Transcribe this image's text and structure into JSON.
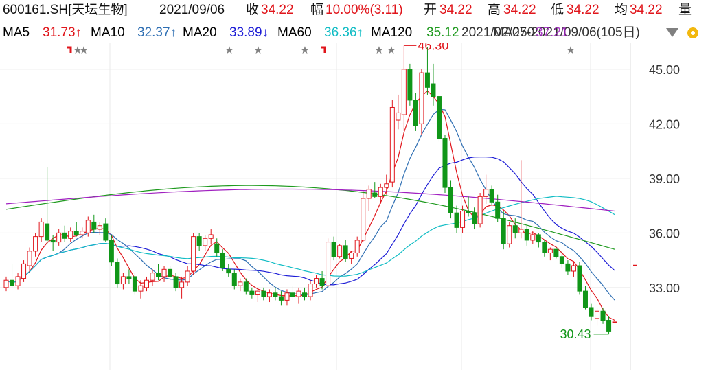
{
  "header": {
    "code": "600161.SH[天坛生物]",
    "date": "2021/09/06",
    "close_label": "收",
    "close": "34.22",
    "change_label": "幅",
    "change": "10.00%(3.11)",
    "open_label": "开",
    "open": "34.22",
    "high_label": "高",
    "high": "34.22",
    "low_label": "低",
    "low": "34.22",
    "avg_label": "均",
    "avg": "34.22",
    "vol_label": "量"
  },
  "ma_bar": {
    "items": [
      {
        "label": "MA5",
        "value": "31.73↑",
        "color": "#e0151b"
      },
      {
        "label": "MA10",
        "value": "32.37↑",
        "color": "#2f6fb3"
      },
      {
        "label": "MA20",
        "value": "33.89↓",
        "color": "#1c1cd6"
      },
      {
        "label": "MA60",
        "value": "36.36↑",
        "color": "#10bcc4"
      },
      {
        "label": "MA120",
        "value": "35.12",
        "color": "#1f9a1f"
      }
    ],
    "range_text": "2021/02/07-2021/09/06(105日)",
    "overlay_text": "MA250",
    "overlay_value": "37.21"
  },
  "chart_data": {
    "type": "candlestick",
    "ylim": [
      30.0,
      47.5
    ],
    "yticks": [
      "33.00",
      "36.00",
      "39.00",
      "42.00",
      "45.00"
    ],
    "high_annotation": "46.30",
    "low_annotation": "30.43",
    "grid": true,
    "colors": {
      "up": "#e0151b",
      "down": "#109618",
      "ma5": "#e0151b",
      "ma10": "#2f6fb3",
      "ma20": "#1c1cd6",
      "ma60": "#10bcc4",
      "ma120": "#1f9a1f",
      "ma250": "#a020c0"
    },
    "candles": [
      {
        "o": 33.0,
        "h": 33.6,
        "l": 32.8,
        "c": 33.4
      },
      {
        "o": 33.4,
        "h": 34.3,
        "l": 33.0,
        "c": 33.1
      },
      {
        "o": 33.1,
        "h": 33.8,
        "l": 32.9,
        "c": 33.6
      },
      {
        "o": 33.5,
        "h": 34.5,
        "l": 33.3,
        "c": 34.3
      },
      {
        "o": 34.2,
        "h": 35.2,
        "l": 33.8,
        "c": 35.0
      },
      {
        "o": 35.0,
        "h": 36.0,
        "l": 34.7,
        "c": 35.8
      },
      {
        "o": 35.8,
        "h": 36.8,
        "l": 35.5,
        "c": 36.6
      },
      {
        "o": 36.5,
        "h": 39.6,
        "l": 35.4,
        "c": 35.6
      },
      {
        "o": 35.6,
        "h": 35.9,
        "l": 35.0,
        "c": 35.5
      },
      {
        "o": 35.5,
        "h": 36.2,
        "l": 35.3,
        "c": 36.0
      },
      {
        "o": 36.0,
        "h": 36.4,
        "l": 35.5,
        "c": 35.7
      },
      {
        "o": 35.7,
        "h": 36.3,
        "l": 35.5,
        "c": 36.1
      },
      {
        "o": 36.1,
        "h": 36.6,
        "l": 35.8,
        "c": 35.9
      },
      {
        "o": 35.9,
        "h": 36.3,
        "l": 35.7,
        "c": 36.1
      },
      {
        "o": 36.0,
        "h": 36.9,
        "l": 35.8,
        "c": 36.7
      },
      {
        "o": 36.6,
        "h": 37.0,
        "l": 36.0,
        "c": 36.2
      },
      {
        "o": 36.2,
        "h": 36.6,
        "l": 35.9,
        "c": 36.4
      },
      {
        "o": 36.5,
        "h": 36.8,
        "l": 35.5,
        "c": 35.6
      },
      {
        "o": 35.6,
        "h": 35.9,
        "l": 34.2,
        "c": 34.4
      },
      {
        "o": 34.4,
        "h": 34.6,
        "l": 33.0,
        "c": 33.2
      },
      {
        "o": 33.2,
        "h": 33.8,
        "l": 32.9,
        "c": 33.6
      },
      {
        "o": 33.6,
        "h": 34.0,
        "l": 33.2,
        "c": 33.5
      },
      {
        "o": 33.6,
        "h": 33.8,
        "l": 32.6,
        "c": 32.8
      },
      {
        "o": 32.8,
        "h": 33.4,
        "l": 32.4,
        "c": 33.1
      },
      {
        "o": 33.0,
        "h": 33.6,
        "l": 32.8,
        "c": 33.4
      },
      {
        "o": 33.4,
        "h": 34.0,
        "l": 33.1,
        "c": 33.8
      },
      {
        "o": 33.8,
        "h": 34.3,
        "l": 33.4,
        "c": 33.6
      },
      {
        "o": 33.6,
        "h": 34.2,
        "l": 33.3,
        "c": 34.0
      },
      {
        "o": 34.0,
        "h": 34.2,
        "l": 33.4,
        "c": 33.6
      },
      {
        "o": 33.6,
        "h": 33.8,
        "l": 32.8,
        "c": 33.0
      },
      {
        "o": 33.0,
        "h": 33.6,
        "l": 32.4,
        "c": 33.3
      },
      {
        "o": 33.3,
        "h": 34.2,
        "l": 33.1,
        "c": 33.9
      },
      {
        "o": 33.9,
        "h": 36.0,
        "l": 33.7,
        "c": 35.8
      },
      {
        "o": 35.8,
        "h": 36.0,
        "l": 35.0,
        "c": 35.3
      },
      {
        "o": 35.3,
        "h": 35.9,
        "l": 35.0,
        "c": 35.7
      },
      {
        "o": 35.7,
        "h": 36.2,
        "l": 35.4,
        "c": 35.9
      },
      {
        "o": 35.4,
        "h": 35.7,
        "l": 34.7,
        "c": 34.9
      },
      {
        "o": 34.9,
        "h": 35.1,
        "l": 33.9,
        "c": 34.1
      },
      {
        "o": 34.0,
        "h": 34.3,
        "l": 33.6,
        "c": 33.8
      },
      {
        "o": 33.8,
        "h": 34.0,
        "l": 32.9,
        "c": 33.1
      },
      {
        "o": 33.1,
        "h": 33.5,
        "l": 32.8,
        "c": 33.3
      },
      {
        "o": 33.3,
        "h": 33.5,
        "l": 32.6,
        "c": 32.8
      },
      {
        "o": 32.8,
        "h": 33.0,
        "l": 32.4,
        "c": 32.6
      },
      {
        "o": 32.6,
        "h": 33.0,
        "l": 32.2,
        "c": 32.8
      },
      {
        "o": 32.8,
        "h": 33.0,
        "l": 32.3,
        "c": 32.5
      },
      {
        "o": 32.5,
        "h": 32.9,
        "l": 32.2,
        "c": 32.7
      },
      {
        "o": 32.7,
        "h": 33.0,
        "l": 32.3,
        "c": 32.5
      },
      {
        "o": 32.5,
        "h": 32.8,
        "l": 32.0,
        "c": 32.3
      },
      {
        "o": 32.3,
        "h": 32.9,
        "l": 32.0,
        "c": 32.7
      },
      {
        "o": 32.7,
        "h": 33.1,
        "l": 32.3,
        "c": 32.5
      },
      {
        "o": 32.5,
        "h": 33.0,
        "l": 32.1,
        "c": 32.8
      },
      {
        "o": 32.7,
        "h": 33.0,
        "l": 32.3,
        "c": 32.5
      },
      {
        "o": 32.5,
        "h": 33.4,
        "l": 32.3,
        "c": 33.2
      },
      {
        "o": 33.2,
        "h": 33.7,
        "l": 33.0,
        "c": 33.5
      },
      {
        "o": 33.5,
        "h": 33.9,
        "l": 32.9,
        "c": 33.1
      },
      {
        "o": 33.1,
        "h": 35.7,
        "l": 33.0,
        "c": 35.5
      },
      {
        "o": 35.5,
        "h": 35.8,
        "l": 34.5,
        "c": 34.7
      },
      {
        "o": 34.7,
        "h": 35.4,
        "l": 34.6,
        "c": 35.3
      },
      {
        "o": 35.3,
        "h": 35.6,
        "l": 34.4,
        "c": 34.6
      },
      {
        "o": 34.6,
        "h": 35.0,
        "l": 34.3,
        "c": 34.9
      },
      {
        "o": 34.9,
        "h": 35.8,
        "l": 34.7,
        "c": 35.6
      },
      {
        "o": 35.6,
        "h": 38.3,
        "l": 35.5,
        "c": 37.9
      },
      {
        "o": 37.9,
        "h": 38.6,
        "l": 37.2,
        "c": 38.4
      },
      {
        "o": 38.2,
        "h": 38.8,
        "l": 37.9,
        "c": 38.0
      },
      {
        "o": 38.0,
        "h": 38.7,
        "l": 37.6,
        "c": 38.5
      },
      {
        "o": 38.5,
        "h": 39.2,
        "l": 38.1,
        "c": 38.7
      },
      {
        "o": 38.8,
        "h": 43.3,
        "l": 38.5,
        "c": 42.9
      },
      {
        "o": 42.2,
        "h": 43.6,
        "l": 41.7,
        "c": 42.6
      },
      {
        "o": 42.5,
        "h": 46.3,
        "l": 41.6,
        "c": 45.0
      },
      {
        "o": 45.0,
        "h": 45.3,
        "l": 43.0,
        "c": 43.3
      },
      {
        "o": 43.3,
        "h": 43.7,
        "l": 41.6,
        "c": 41.9
      },
      {
        "o": 42.0,
        "h": 45.0,
        "l": 41.4,
        "c": 44.8
      },
      {
        "o": 44.8,
        "h": 46.2,
        "l": 43.6,
        "c": 44.0
      },
      {
        "o": 44.2,
        "h": 45.3,
        "l": 43.0,
        "c": 43.5
      },
      {
        "o": 43.5,
        "h": 43.6,
        "l": 41.0,
        "c": 41.2
      },
      {
        "o": 41.2,
        "h": 41.4,
        "l": 38.2,
        "c": 38.5
      },
      {
        "o": 38.5,
        "h": 38.9,
        "l": 36.8,
        "c": 37.1
      },
      {
        "o": 37.1,
        "h": 37.5,
        "l": 36.0,
        "c": 36.3
      },
      {
        "o": 36.3,
        "h": 37.5,
        "l": 36.0,
        "c": 37.2
      },
      {
        "o": 37.2,
        "h": 38.0,
        "l": 36.9,
        "c": 37.1
      },
      {
        "o": 37.1,
        "h": 37.4,
        "l": 36.2,
        "c": 36.5
      },
      {
        "o": 36.5,
        "h": 38.2,
        "l": 36.3,
        "c": 38.0
      },
      {
        "o": 38.0,
        "h": 39.2,
        "l": 37.6,
        "c": 38.4
      },
      {
        "o": 38.4,
        "h": 38.6,
        "l": 37.5,
        "c": 37.7
      },
      {
        "o": 37.7,
        "h": 38.1,
        "l": 36.6,
        "c": 36.8
      },
      {
        "o": 36.8,
        "h": 37.2,
        "l": 35.1,
        "c": 35.4
      },
      {
        "o": 35.4,
        "h": 36.6,
        "l": 35.2,
        "c": 36.4
      },
      {
        "o": 36.4,
        "h": 36.8,
        "l": 35.7,
        "c": 36.0
      },
      {
        "o": 36.0,
        "h": 40.0,
        "l": 35.7,
        "c": 36.2
      },
      {
        "o": 36.2,
        "h": 36.4,
        "l": 35.3,
        "c": 35.6
      },
      {
        "o": 35.6,
        "h": 36.1,
        "l": 35.4,
        "c": 35.9
      },
      {
        "o": 35.9,
        "h": 36.0,
        "l": 35.2,
        "c": 35.5
      },
      {
        "o": 35.5,
        "h": 35.6,
        "l": 34.7,
        "c": 34.9
      },
      {
        "o": 34.9,
        "h": 35.2,
        "l": 34.5,
        "c": 35.1
      },
      {
        "o": 35.1,
        "h": 35.2,
        "l": 34.6,
        "c": 34.7
      },
      {
        "o": 34.7,
        "h": 35.0,
        "l": 34.1,
        "c": 34.3
      },
      {
        "o": 34.3,
        "h": 34.5,
        "l": 33.7,
        "c": 33.9
      },
      {
        "o": 33.9,
        "h": 34.4,
        "l": 33.6,
        "c": 34.2
      },
      {
        "o": 34.2,
        "h": 34.4,
        "l": 32.6,
        "c": 32.8
      },
      {
        "o": 32.8,
        "h": 33.1,
        "l": 31.8,
        "c": 31.9
      },
      {
        "o": 31.9,
        "h": 32.1,
        "l": 31.2,
        "c": 31.4
      },
      {
        "o": 31.3,
        "h": 31.9,
        "l": 30.9,
        "c": 31.7
      },
      {
        "o": 31.7,
        "h": 31.9,
        "l": 31.0,
        "c": 31.2
      },
      {
        "o": 31.2,
        "h": 31.4,
        "l": 30.43,
        "c": 30.6
      },
      {
        "o": 31.11,
        "h": 31.11,
        "l": 31.11,
        "c": 31.11
      }
    ]
  }
}
